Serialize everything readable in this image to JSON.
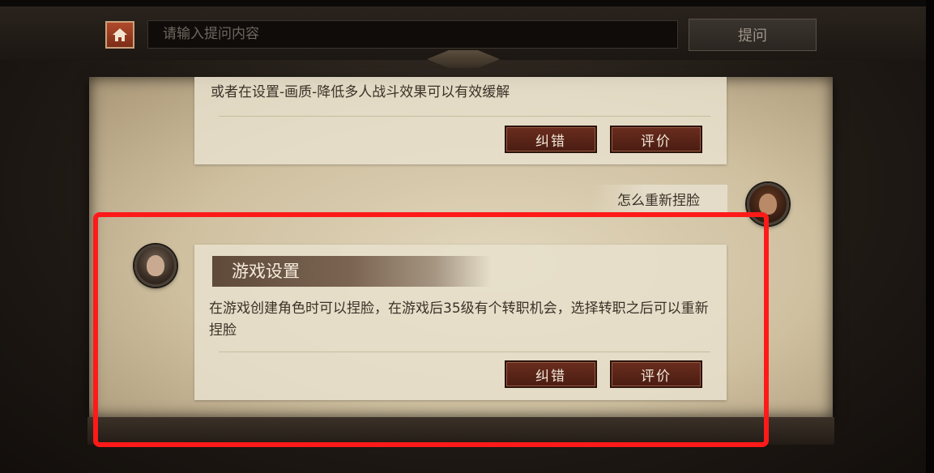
{
  "topbar": {
    "search_placeholder": "请输入提问内容",
    "ask_label": "提问"
  },
  "previous_answer": {
    "text": "或者在设置-画质-降低多人战斗效果可以有效缓解",
    "correct_label": "纠错",
    "rate_label": "评价"
  },
  "user_question": {
    "text": "怎么重新捏脸"
  },
  "answer": {
    "title": "游戏设置",
    "text": "在游戏创建角色时可以捏脸，在游戏后35级有个转职机会，选择转职之后可以重新捏脸",
    "correct_label": "纠错",
    "rate_label": "评价"
  },
  "colors": {
    "highlight": "#ff1a1a",
    "button": "#5a2418",
    "parchment": "#d9ccaf"
  }
}
